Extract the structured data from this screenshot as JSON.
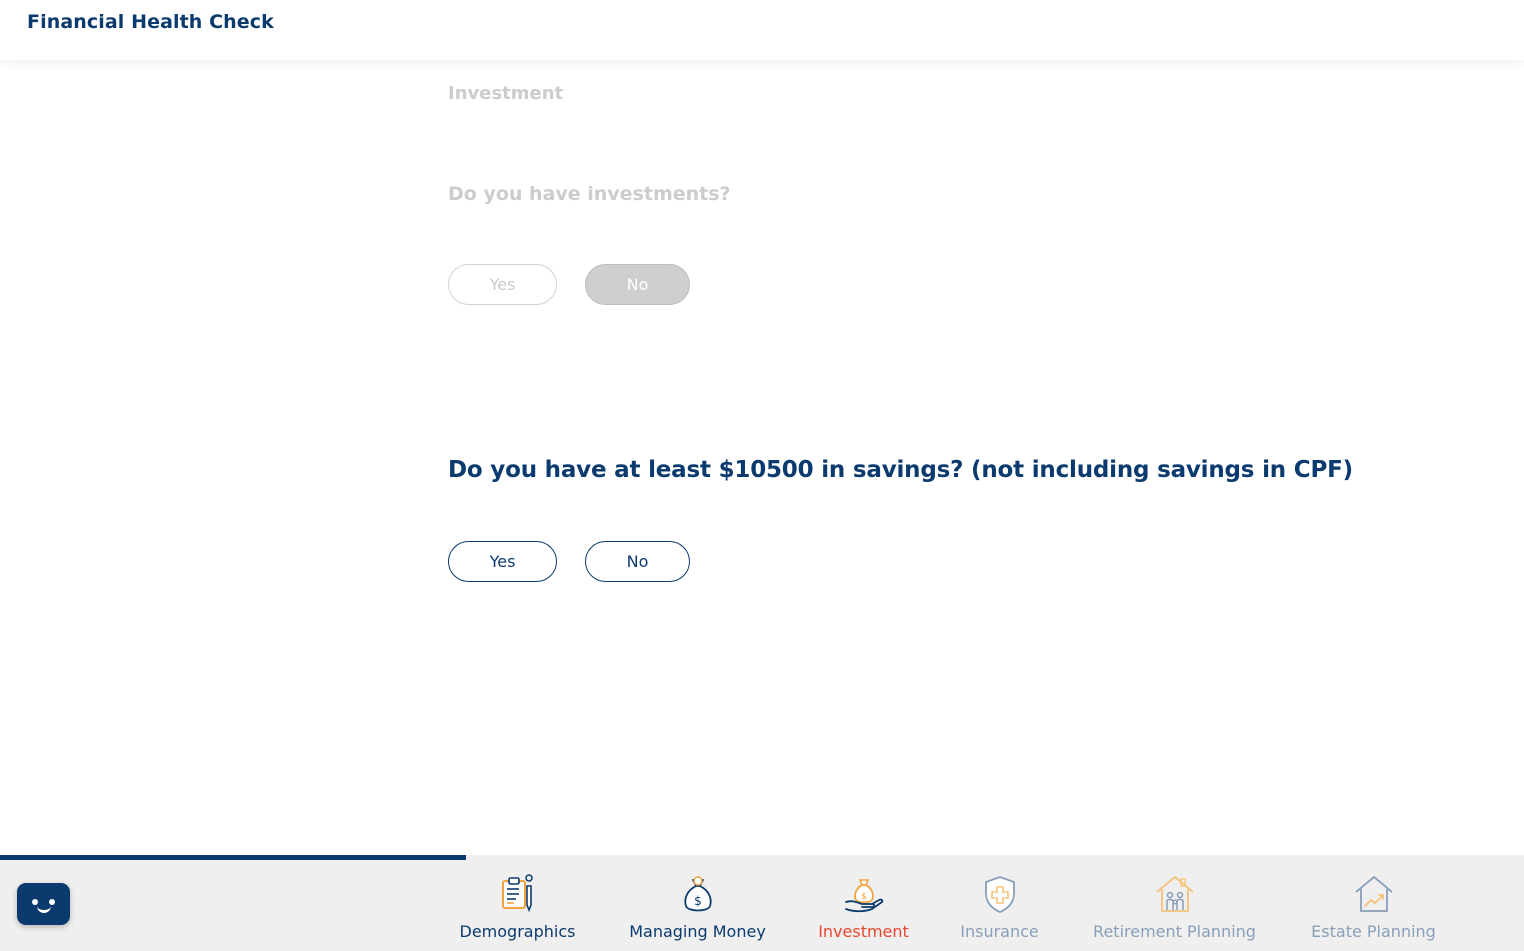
{
  "header": {
    "title": "Financial Health Check"
  },
  "section": {
    "title": "Investment"
  },
  "question1": {
    "text": "Do you have investments?",
    "yes_label": "Yes",
    "no_label": "No",
    "selected": "No"
  },
  "question2": {
    "text": "Do you have at least $10500 in savings? (not including savings in CPF)",
    "yes_label": "Yes",
    "no_label": "No"
  },
  "progress": {
    "fraction": 0.306
  },
  "colors": {
    "primary": "#0b3a6e",
    "active": "#e8472c",
    "accent_orange": "#f2a33a",
    "muted": "#8a9fb8",
    "disabled": "#cccccc"
  },
  "nav": {
    "items": [
      {
        "label": "Demographics",
        "icon": "clipboard-pen-icon",
        "state": "done"
      },
      {
        "label": "Managing Money",
        "icon": "money-bag-icon",
        "state": "done"
      },
      {
        "label": "Investment",
        "icon": "hand-money-bag-icon",
        "state": "active"
      },
      {
        "label": "Insurance",
        "icon": "shield-cross-icon",
        "state": "todo"
      },
      {
        "label": "Retirement Planning",
        "icon": "house-family-icon",
        "state": "todo"
      },
      {
        "label": "Estate Planning",
        "icon": "house-growth-icon",
        "state": "todo"
      }
    ]
  },
  "chat": {
    "icon": "chatbot-face-icon"
  }
}
